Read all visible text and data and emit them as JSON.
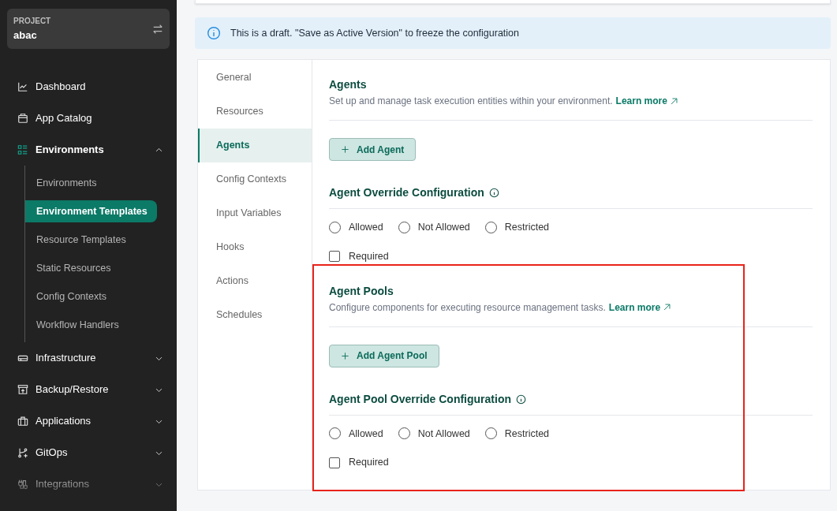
{
  "project": {
    "label": "PROJECT",
    "name": "abac"
  },
  "nav": [
    {
      "label": "Dashboard",
      "active": false
    },
    {
      "label": "App Catalog",
      "active": false
    },
    {
      "label": "Environments",
      "active": true,
      "expanded": true,
      "children": [
        {
          "label": "Environments",
          "selected": false
        },
        {
          "label": "Environment Templates",
          "selected": true
        },
        {
          "label": "Resource Templates",
          "selected": false
        },
        {
          "label": "Static Resources",
          "selected": false
        },
        {
          "label": "Config Contexts",
          "selected": false
        },
        {
          "label": "Workflow Handlers",
          "selected": false
        }
      ]
    },
    {
      "label": "Infrastructure",
      "active": false,
      "expanded": false
    },
    {
      "label": "Backup/Restore",
      "active": false,
      "expanded": false
    },
    {
      "label": "Applications",
      "active": false,
      "expanded": false
    },
    {
      "label": "GitOps",
      "active": false,
      "expanded": false
    },
    {
      "label": "Integrations",
      "active": false,
      "expanded": false
    }
  ],
  "banner": "This is a draft. \"Save as Active Version\" to freeze the configuration",
  "tabs": [
    {
      "label": "General",
      "selected": false
    },
    {
      "label": "Resources",
      "selected": false
    },
    {
      "label": "Agents",
      "selected": true
    },
    {
      "label": "Config Contexts",
      "selected": false
    },
    {
      "label": "Input Variables",
      "selected": false
    },
    {
      "label": "Hooks",
      "selected": false
    },
    {
      "label": "Actions",
      "selected": false
    },
    {
      "label": "Schedules",
      "selected": false
    }
  ],
  "groups": [
    {
      "highlighted": false,
      "sections": [
        {
          "kind": "entity",
          "title": "Agents",
          "description": "Set up and manage task execution entities within your environment.",
          "link": "Learn more",
          "button": "Add Agent"
        },
        {
          "kind": "override",
          "title": "Agent Override Configuration",
          "options": [
            {
              "label": "Allowed",
              "selected": false
            },
            {
              "label": "Not Allowed",
              "selected": false
            },
            {
              "label": "Restricted",
              "selected": false
            }
          ],
          "required": {
            "label": "Required",
            "checked": false
          }
        }
      ]
    },
    {
      "highlighted": true,
      "sections": [
        {
          "kind": "entity",
          "title": "Agent Pools",
          "description": "Configure components for executing resource management tasks.",
          "link": "Learn more",
          "button": "Add Agent Pool"
        },
        {
          "kind": "override",
          "title": "Agent Pool Override Configuration",
          "options": [
            {
              "label": "Allowed",
              "selected": false
            },
            {
              "label": "Not Allowed",
              "selected": false
            },
            {
              "label": "Restricted",
              "selected": false
            }
          ],
          "required": {
            "label": "Required",
            "checked": false
          }
        }
      ]
    }
  ]
}
